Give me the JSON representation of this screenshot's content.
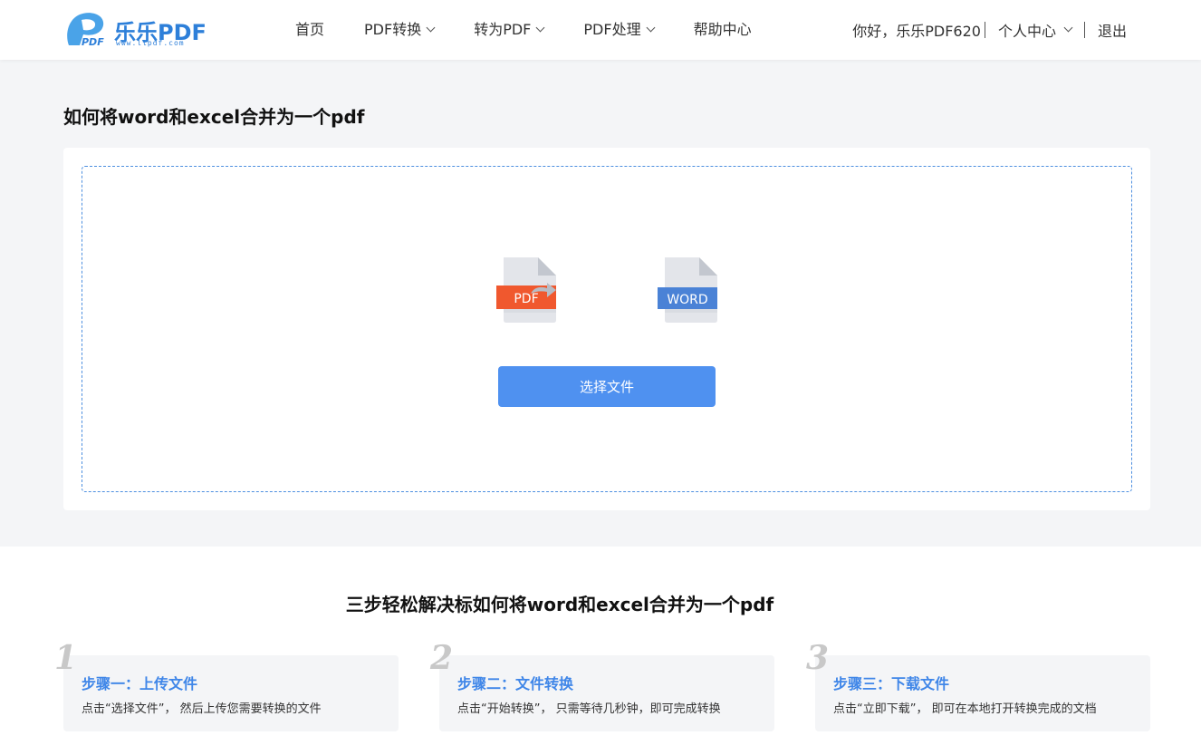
{
  "header": {
    "logo_text": "乐乐PDF",
    "logo_sub": "www.llpdf.com",
    "logo_badge": "PDF",
    "nav": [
      {
        "label": "首页",
        "has_dropdown": false
      },
      {
        "label": "PDF转换",
        "has_dropdown": true
      },
      {
        "label": "转为PDF",
        "has_dropdown": true
      },
      {
        "label": "PDF处理",
        "has_dropdown": true
      },
      {
        "label": "帮助中心",
        "has_dropdown": false
      }
    ],
    "greeting": "你好，乐乐PDF620",
    "user_center": "个人中心",
    "logout": "退出"
  },
  "main": {
    "title": "如何将word和excel合并为一个pdf",
    "from_format": "PDF",
    "to_format": "WORD",
    "select_button": "选择文件"
  },
  "steps_section": {
    "title": "三步轻松解决标如何将word和excel合并为一个pdf",
    "steps": [
      {
        "num": "1",
        "title": "步骤一：上传文件",
        "desc": "点击“选择文件”， 然后上传您需要转换的文件"
      },
      {
        "num": "2",
        "title": "步骤二：文件转换",
        "desc": "点击“开始转换”， 只需等待几秒钟，即可完成转换"
      },
      {
        "num": "3",
        "title": "步骤三：下载文件",
        "desc": "点击“立即下载”， 即可在本地打开转换完成的文档"
      }
    ]
  },
  "colors": {
    "brand": "#2d7fd9",
    "button": "#4f91f0",
    "pdf_badge": "#f0582e",
    "word_badge": "#4a82d6",
    "step_title": "#3f86e8"
  }
}
